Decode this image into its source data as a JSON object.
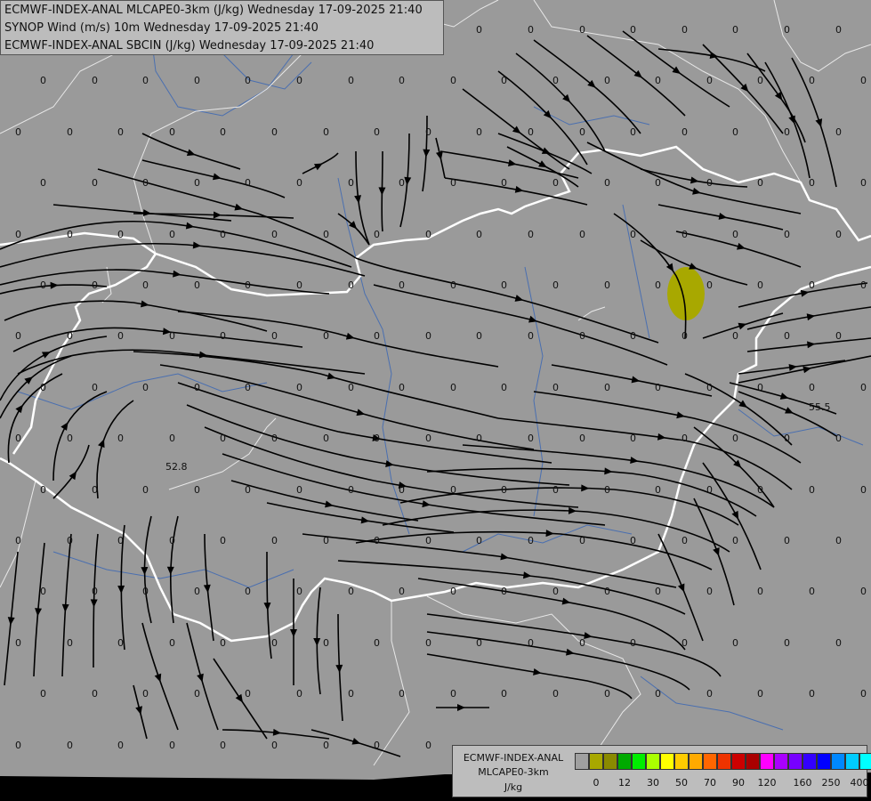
{
  "title_lines": [
    "ECMWF-INDEX-ANAL MLCAPE0-3km (J/kg) Wednesday 17-09-2025 21:40",
    "SYNOP Wind (m/s) 10m Wednesday 17-09-2025 21:40",
    "ECMWF-INDEX-ANAL SBCIN (J/kg) Wednesday 17-09-2025 21:40"
  ],
  "legend": {
    "line1": "ECMWF-INDEX-ANAL",
    "line2": "MLCAPE0-3km",
    "unit": "J/kg",
    "colors": [
      "#a0a0a0",
      "#a8a800",
      "#8a8a00",
      "#00aa00",
      "#00ee00",
      "#aaff00",
      "#ffff00",
      "#ffcc00",
      "#ffaa00",
      "#ff6600",
      "#ee3300",
      "#cc0000",
      "#aa0000",
      "#ff00ff",
      "#aa00ff",
      "#7700ff",
      "#3300ff",
      "#0000ff",
      "#0088ff",
      "#00ccff",
      "#00ffff",
      "#aaffff",
      "#ffffff"
    ],
    "tick_labels": [
      "0",
      "12",
      "30",
      "50",
      "70",
      "90",
      "120",
      "160",
      "250",
      "400"
    ]
  },
  "map": {
    "value_labels": [
      "52.8",
      "55.5"
    ],
    "zero_label": "0",
    "cape_patch_color": "#a8a800"
  }
}
